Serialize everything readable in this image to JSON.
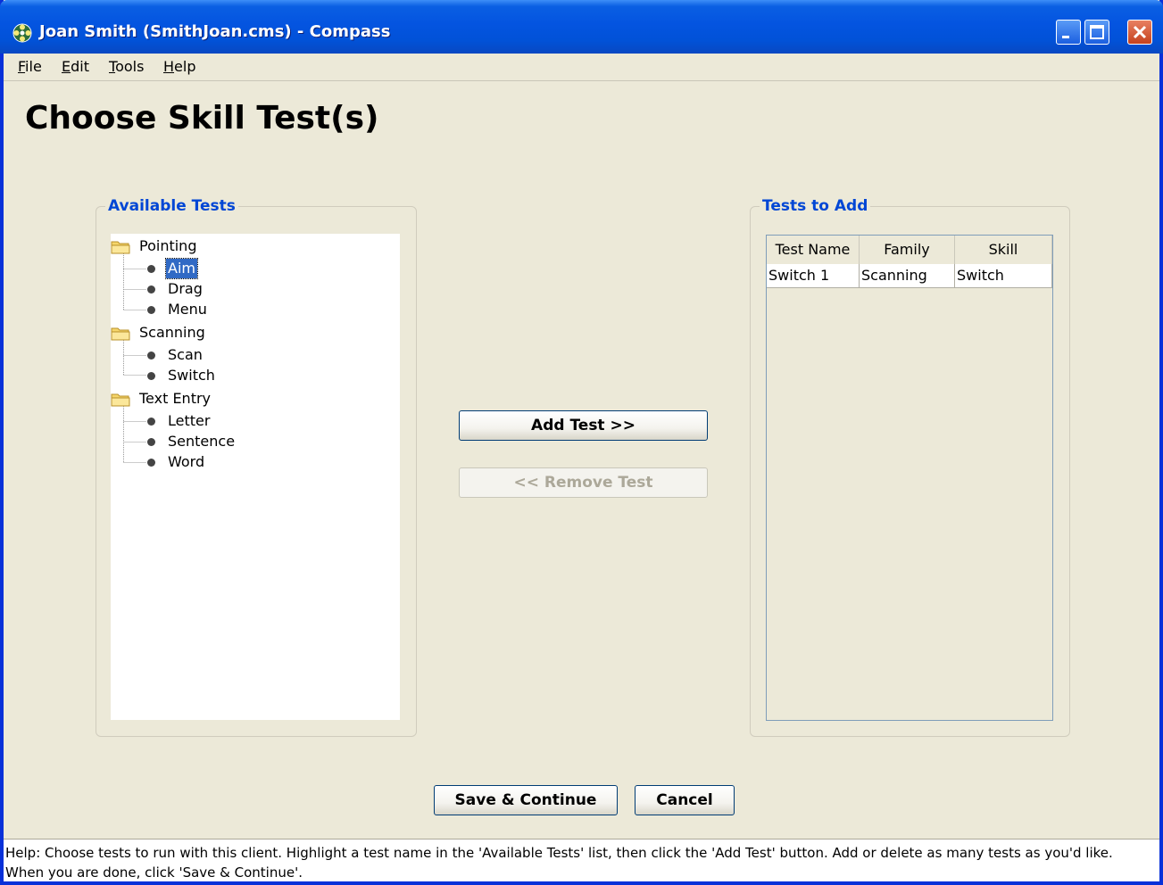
{
  "window": {
    "title": "Joan Smith (SmithJoan.cms) - Compass",
    "icon": "compass-app-icon"
  },
  "menu": {
    "items": [
      {
        "label": "File",
        "mnemonic": "F"
      },
      {
        "label": "Edit",
        "mnemonic": "E"
      },
      {
        "label": "Tools",
        "mnemonic": "T"
      },
      {
        "label": "Help",
        "mnemonic": "H"
      }
    ]
  },
  "page": {
    "title": "Choose Skill Test(s)"
  },
  "available": {
    "legend": "Available Tests",
    "groups": [
      {
        "label": "Pointing",
        "items": [
          "Aim",
          "Drag",
          "Menu"
        ]
      },
      {
        "label": "Scanning",
        "items": [
          "Scan",
          "Switch"
        ]
      },
      {
        "label": "Text Entry",
        "items": [
          "Letter",
          "Sentence",
          "Word"
        ]
      }
    ],
    "selected": "Aim"
  },
  "actions": {
    "add": "Add Test >>",
    "remove": "<< Remove Test"
  },
  "to_add": {
    "legend": "Tests to Add",
    "columns": [
      "Test Name",
      "Family",
      "Skill"
    ],
    "rows": [
      [
        "Switch 1",
        "Scanning",
        "Switch"
      ]
    ]
  },
  "footer": {
    "save": "Save & Continue",
    "cancel": "Cancel"
  },
  "help": {
    "text": "Help:  Choose tests to run with this client.  Highlight a test name in the 'Available Tests' list, then click the 'Add Test' button.  Add or delete as many tests as you'd like.  When you are done, click 'Save & Continue'."
  },
  "colors": {
    "titlebar": "#0454e0",
    "legend": "#0046d5",
    "selection": "#316ac5",
    "window_bg": "#ece9d8"
  }
}
